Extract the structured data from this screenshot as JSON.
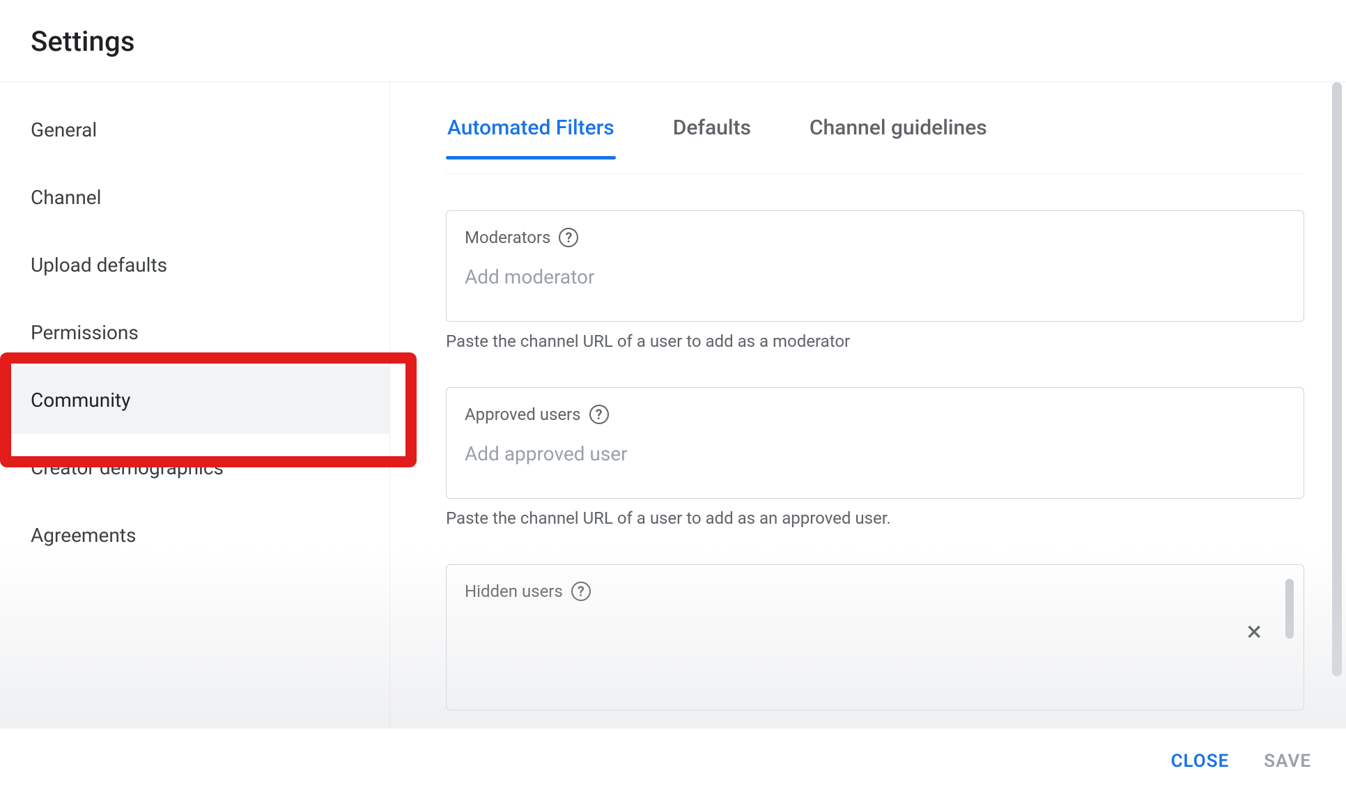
{
  "header": {
    "title": "Settings"
  },
  "sidebar": {
    "items": [
      {
        "label": "General"
      },
      {
        "label": "Channel"
      },
      {
        "label": "Upload defaults"
      },
      {
        "label": "Permissions"
      },
      {
        "label": "Community"
      },
      {
        "label": "Creator demographics"
      },
      {
        "label": "Agreements"
      }
    ],
    "active_index": 4
  },
  "tabs": {
    "items": [
      {
        "label": "Automated Filters"
      },
      {
        "label": "Defaults"
      },
      {
        "label": "Channel guidelines"
      }
    ],
    "active_index": 0
  },
  "fields": {
    "moderators": {
      "label": "Moderators",
      "placeholder": "Add moderator",
      "helper": "Paste the channel URL of a user to add as a moderator"
    },
    "approved": {
      "label": "Approved users",
      "placeholder": "Add approved user",
      "helper": "Paste the channel URL of a user to add as an approved user."
    },
    "hidden": {
      "label": "Hidden users",
      "placeholder": "",
      "chip_close": "×"
    }
  },
  "footer": {
    "close_label": "CLOSE",
    "save_label": "SAVE"
  },
  "help_glyph": "?"
}
